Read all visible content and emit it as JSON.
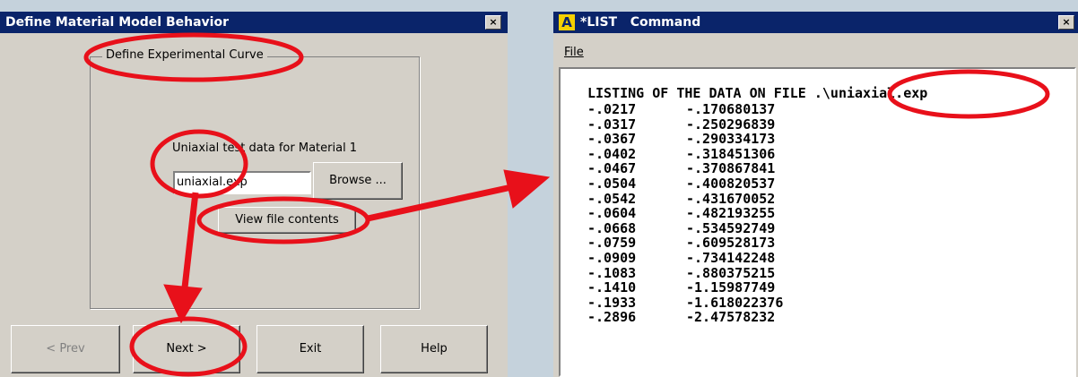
{
  "left_dialog": {
    "title": "Define Material Model Behavior",
    "close_label": "×",
    "group_title": "Define Experimental Curve",
    "prompt": "Uniaxial test data for Material 1",
    "file_input_value": "uniaxial.exp",
    "browse_label": "Browse ...",
    "view_label": "View file contents",
    "buttons": {
      "prev": "< Prev",
      "next": "Next >",
      "exit": "Exit",
      "help": "Help"
    }
  },
  "right_window": {
    "logo_glyph": "A",
    "title": "*LIST   Command",
    "close_label": "×",
    "menu_file": "File",
    "header": "LISTING OF THE DATA ON FILE .\\uniaxial.exp",
    "rows": [
      [
        "-.0217",
        "-.170680137"
      ],
      [
        "-.0317",
        "-.250296839"
      ],
      [
        "-.0367",
        "-.290334173"
      ],
      [
        "-.0402",
        "-.318451306"
      ],
      [
        "-.0467",
        "-.370867841"
      ],
      [
        "-.0504",
        "-.400820537"
      ],
      [
        "-.0542",
        "-.431670052"
      ],
      [
        "-.0604",
        "-.482193255"
      ],
      [
        "-.0668",
        "-.534592749"
      ],
      [
        "-.0759",
        "-.609528173"
      ],
      [
        "-.0909",
        "-.734142248"
      ],
      [
        "-.1083",
        "-.880375215"
      ],
      [
        "-.1410",
        "-1.15987749"
      ],
      [
        "-.1933",
        "-1.618022376"
      ],
      [
        "-.2896",
        "-2.47578232"
      ]
    ]
  },
  "colors": {
    "annotation": "#e8101a",
    "titlebar": "#0a246a",
    "window": "#d4d0c8"
  }
}
